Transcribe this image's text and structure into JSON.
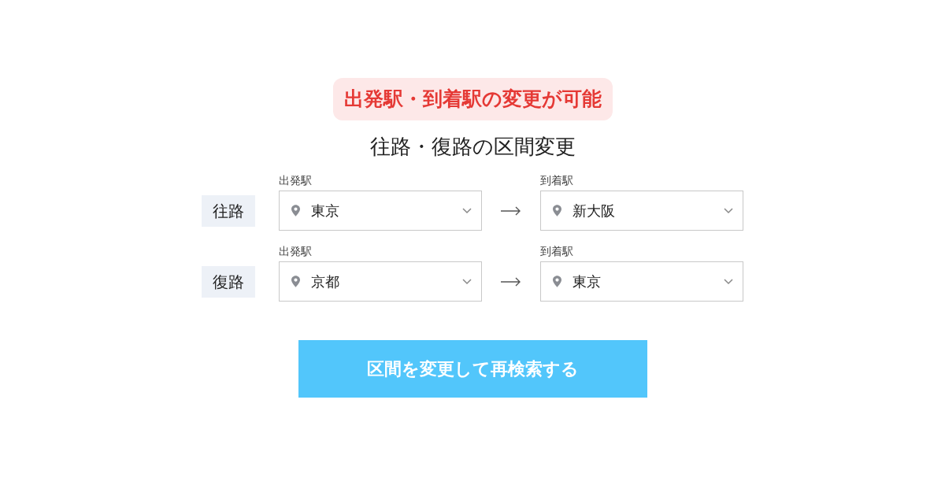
{
  "notice": "出発駅・到着駅の変更が可能",
  "title": "往路・復路の区間変更",
  "routes": [
    {
      "label": "往路",
      "departure": {
        "caption": "出発駅",
        "value": "東京"
      },
      "arrival": {
        "caption": "到着駅",
        "value": "新大阪"
      }
    },
    {
      "label": "復路",
      "departure": {
        "caption": "出発駅",
        "value": "京都"
      },
      "arrival": {
        "caption": "到着駅",
        "value": "東京"
      }
    }
  ],
  "submit_button": "区間を変更して再検索する"
}
